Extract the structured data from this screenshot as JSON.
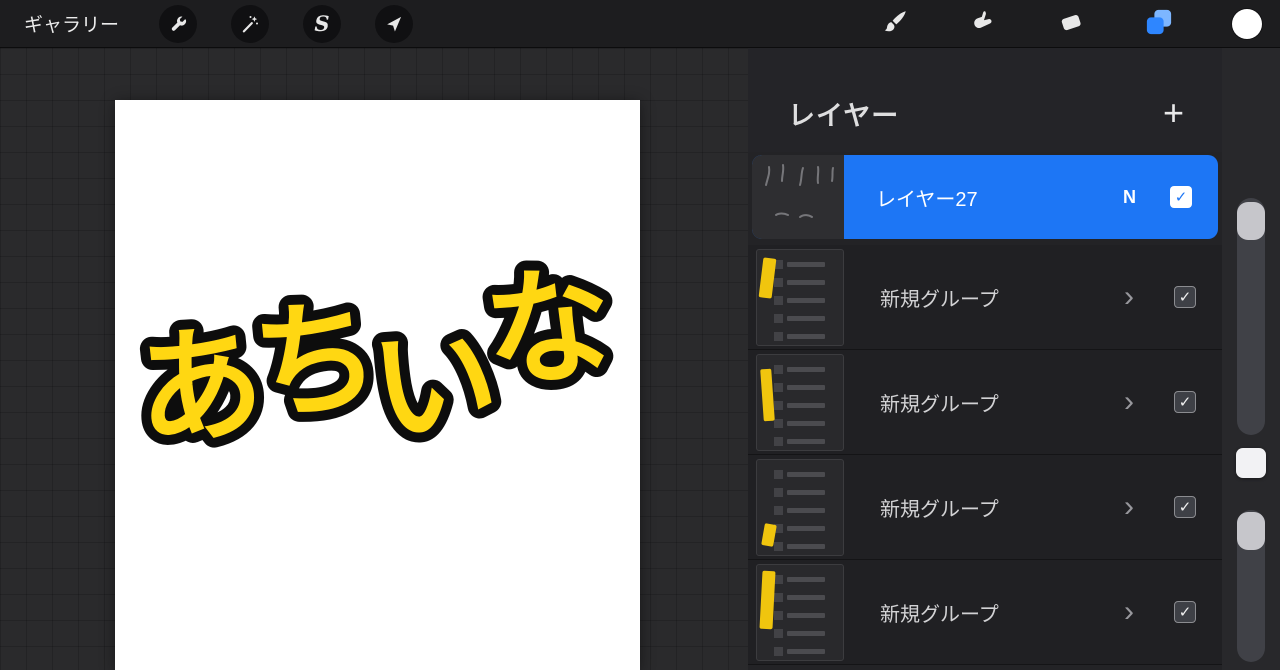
{
  "topbar": {
    "gallery_label": "ギャラリー",
    "selection_glyph": "S"
  },
  "canvas": {
    "word": "あちいな",
    "letters": [
      "あ",
      "ち",
      "い",
      "な"
    ]
  },
  "layers_panel": {
    "title": "レイヤー",
    "selected_layer": {
      "name": "レイヤー27",
      "blend_mode": "N"
    },
    "groups": [
      {
        "name": "新規グループ"
      },
      {
        "name": "新規グループ"
      },
      {
        "name": "新規グループ"
      },
      {
        "name": "新規グループ"
      }
    ]
  },
  "glyphs": {
    "plus": "+",
    "check": "✓",
    "chevron": "›"
  },
  "colors": {
    "selection_blue": "#1d76f5",
    "letter_yellow": "#ffd712",
    "letter_outline": "#0d0d0d",
    "panel_bg": "#232326",
    "grid_bg": "#2a2a2c",
    "thumb_accent_yellow": "#f0c50e"
  }
}
